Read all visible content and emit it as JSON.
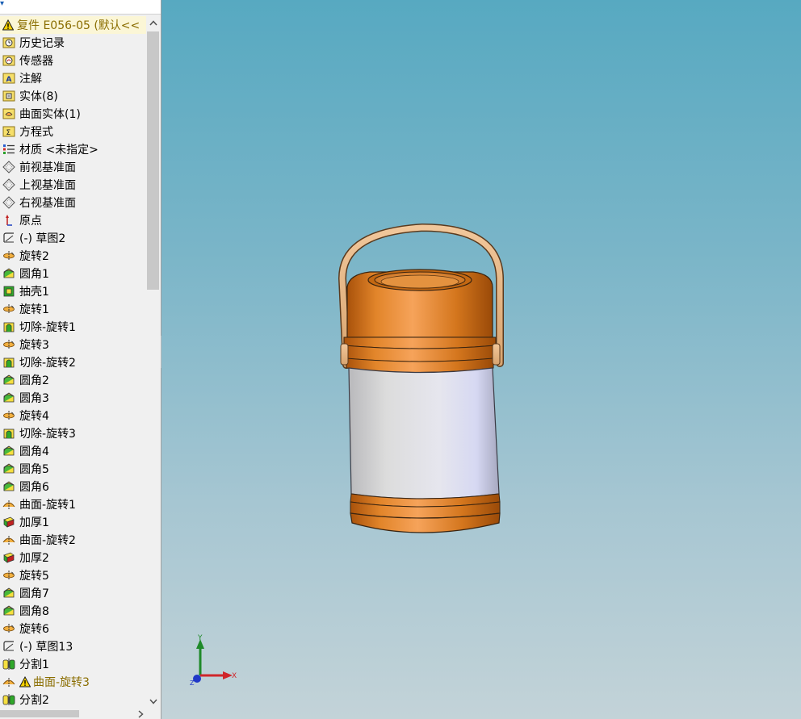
{
  "tree": {
    "root_label": "复件 E056-05  (默认<<",
    "items": [
      {
        "label": "历史记录",
        "icon": "history-folder-icon"
      },
      {
        "label": "传感器",
        "icon": "sensors-folder-icon"
      },
      {
        "label": "注解",
        "icon": "annotations-folder-icon"
      },
      {
        "label": "实体(8)",
        "icon": "solid-bodies-folder-icon"
      },
      {
        "label": "曲面实体(1)",
        "icon": "surface-bodies-folder-icon"
      },
      {
        "label": "方程式",
        "icon": "equations-folder-icon"
      },
      {
        "label": "材质 <未指定>",
        "icon": "material-icon"
      },
      {
        "label": "前视基准面",
        "icon": "plane-icon"
      },
      {
        "label": "上视基准面",
        "icon": "plane-icon"
      },
      {
        "label": "右视基准面",
        "icon": "plane-icon"
      },
      {
        "label": "原点",
        "icon": "origin-icon"
      },
      {
        "label": "(-) 草图2",
        "icon": "sketch-icon"
      },
      {
        "label": "旋转2",
        "icon": "revolve-icon"
      },
      {
        "label": "圆角1",
        "icon": "fillet-icon"
      },
      {
        "label": "抽壳1",
        "icon": "shell-icon"
      },
      {
        "label": "旋转1",
        "icon": "revolve-icon"
      },
      {
        "label": "切除-旋转1",
        "icon": "cut-revolve-icon"
      },
      {
        "label": "旋转3",
        "icon": "revolve-icon"
      },
      {
        "label": "切除-旋转2",
        "icon": "cut-revolve-icon"
      },
      {
        "label": "圆角2",
        "icon": "fillet-icon"
      },
      {
        "label": "圆角3",
        "icon": "fillet-icon"
      },
      {
        "label": "旋转4",
        "icon": "revolve-icon"
      },
      {
        "label": "切除-旋转3",
        "icon": "cut-revolve-icon"
      },
      {
        "label": "圆角4",
        "icon": "fillet-icon"
      },
      {
        "label": "圆角5",
        "icon": "fillet-icon"
      },
      {
        "label": "圆角6",
        "icon": "fillet-icon"
      },
      {
        "label": "曲面-旋转1",
        "icon": "surface-revolve-icon"
      },
      {
        "label": "加厚1",
        "icon": "thicken-icon"
      },
      {
        "label": "曲面-旋转2",
        "icon": "surface-revolve-icon"
      },
      {
        "label": "加厚2",
        "icon": "thicken-icon"
      },
      {
        "label": "旋转5",
        "icon": "revolve-icon"
      },
      {
        "label": "圆角7",
        "icon": "fillet-icon"
      },
      {
        "label": "圆角8",
        "icon": "fillet-icon"
      },
      {
        "label": "旋转6",
        "icon": "revolve-icon"
      },
      {
        "label": "(-) 草图13",
        "icon": "sketch-icon"
      },
      {
        "label": "分割1",
        "icon": "split-icon"
      },
      {
        "label": "曲面-旋转3",
        "icon": "surface-revolve-icon",
        "warning": true
      },
      {
        "label": "分割2",
        "icon": "split-icon"
      }
    ]
  },
  "triad": {
    "x_label": "X",
    "y_label": "Y",
    "z_label": "Z"
  },
  "colors": {
    "viewport_top": "#57a9c1",
    "viewport_bottom": "#c3d3d8",
    "jar_orange": "#d97a1e",
    "jar_silver": "#e2e4ec",
    "handle_tan": "#e7b989",
    "warning_yellow": "#f5d000"
  }
}
